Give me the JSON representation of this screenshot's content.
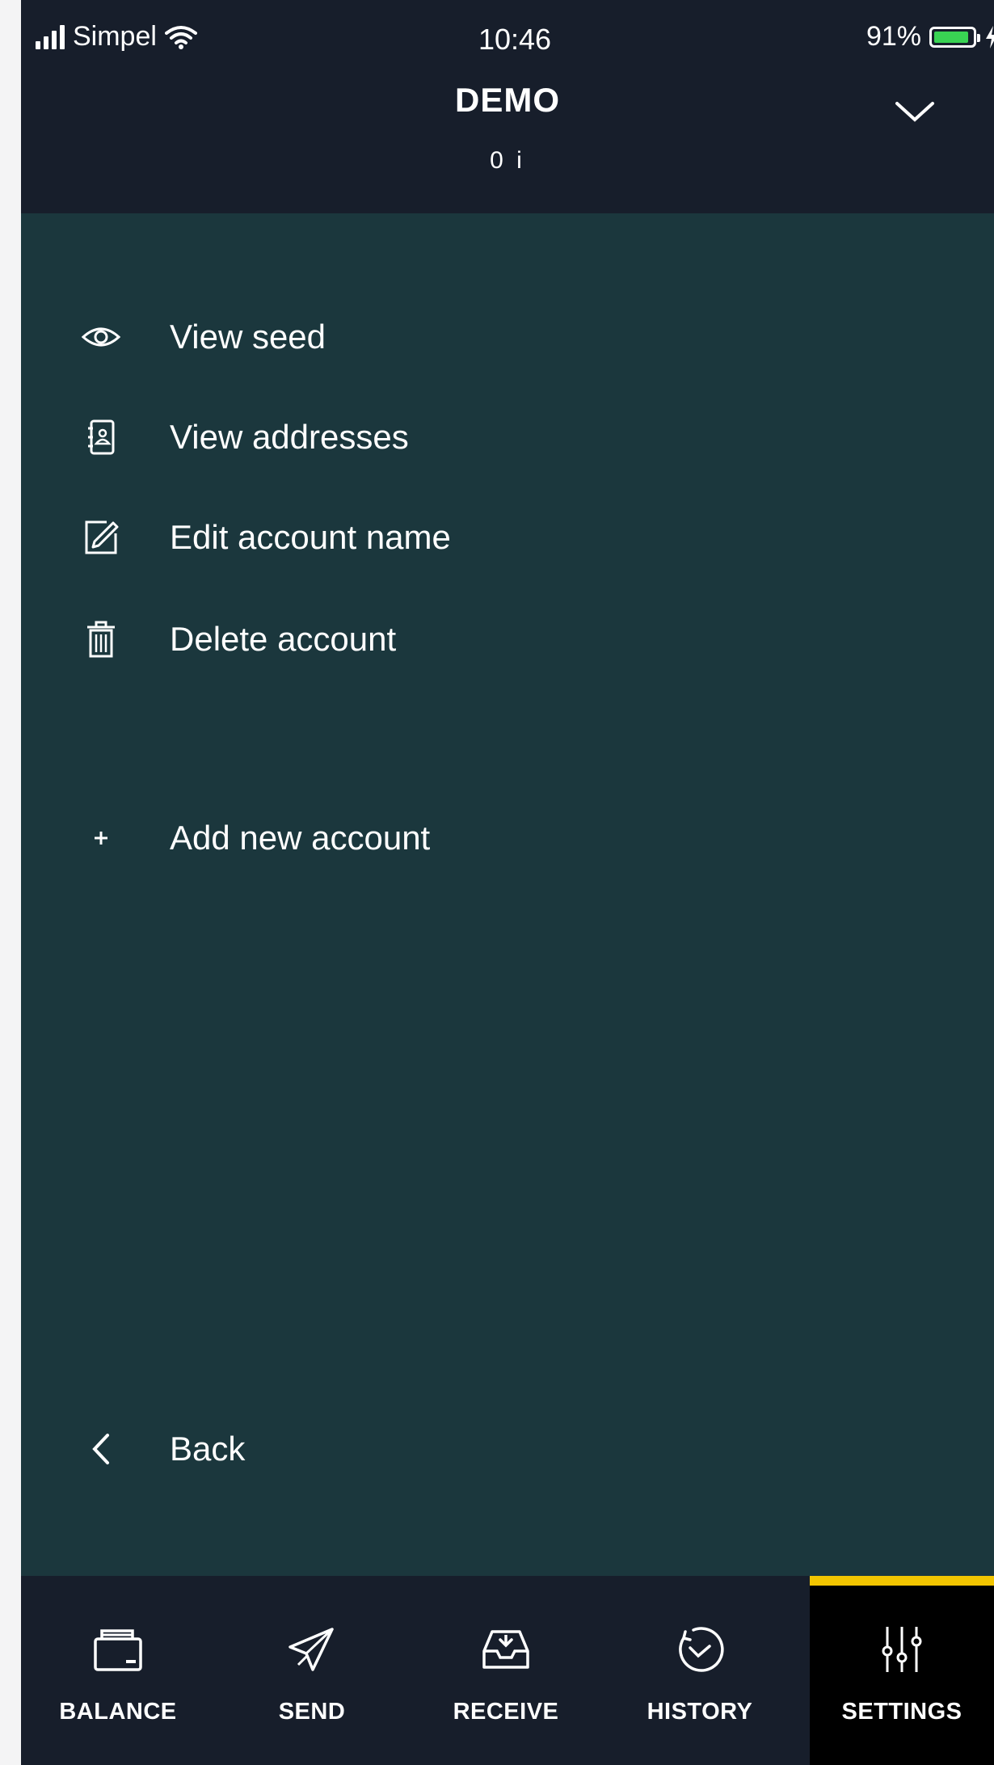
{
  "status_bar": {
    "carrier": "Simpel",
    "time": "10:46",
    "battery_percent": "91%",
    "battery_level": 0.91
  },
  "header": {
    "title": "DEMO",
    "balance": "0 i"
  },
  "menu": {
    "items": [
      {
        "label": "View seed",
        "icon": "eye-icon"
      },
      {
        "label": "View addresses",
        "icon": "address-book-icon"
      },
      {
        "label": "Edit account name",
        "icon": "edit-icon"
      },
      {
        "label": "Delete account",
        "icon": "trash-icon"
      }
    ],
    "add_account": {
      "label": "Add new account",
      "icon": "plus-icon"
    },
    "back": {
      "label": "Back",
      "icon": "chevron-left-icon"
    }
  },
  "tabs": [
    {
      "label": "BALANCE",
      "icon": "wallet-icon"
    },
    {
      "label": "SEND",
      "icon": "paper-plane-icon"
    },
    {
      "label": "RECEIVE",
      "icon": "inbox-icon"
    },
    {
      "label": "HISTORY",
      "icon": "history-icon"
    },
    {
      "label": "SETTINGS",
      "icon": "sliders-icon"
    }
  ],
  "active_tab": "SETTINGS",
  "colors": {
    "background": "#1b373d",
    "header": "#171e2b",
    "active_tab": "#000000",
    "accent": "#f2c500",
    "battery": "#39d353"
  }
}
